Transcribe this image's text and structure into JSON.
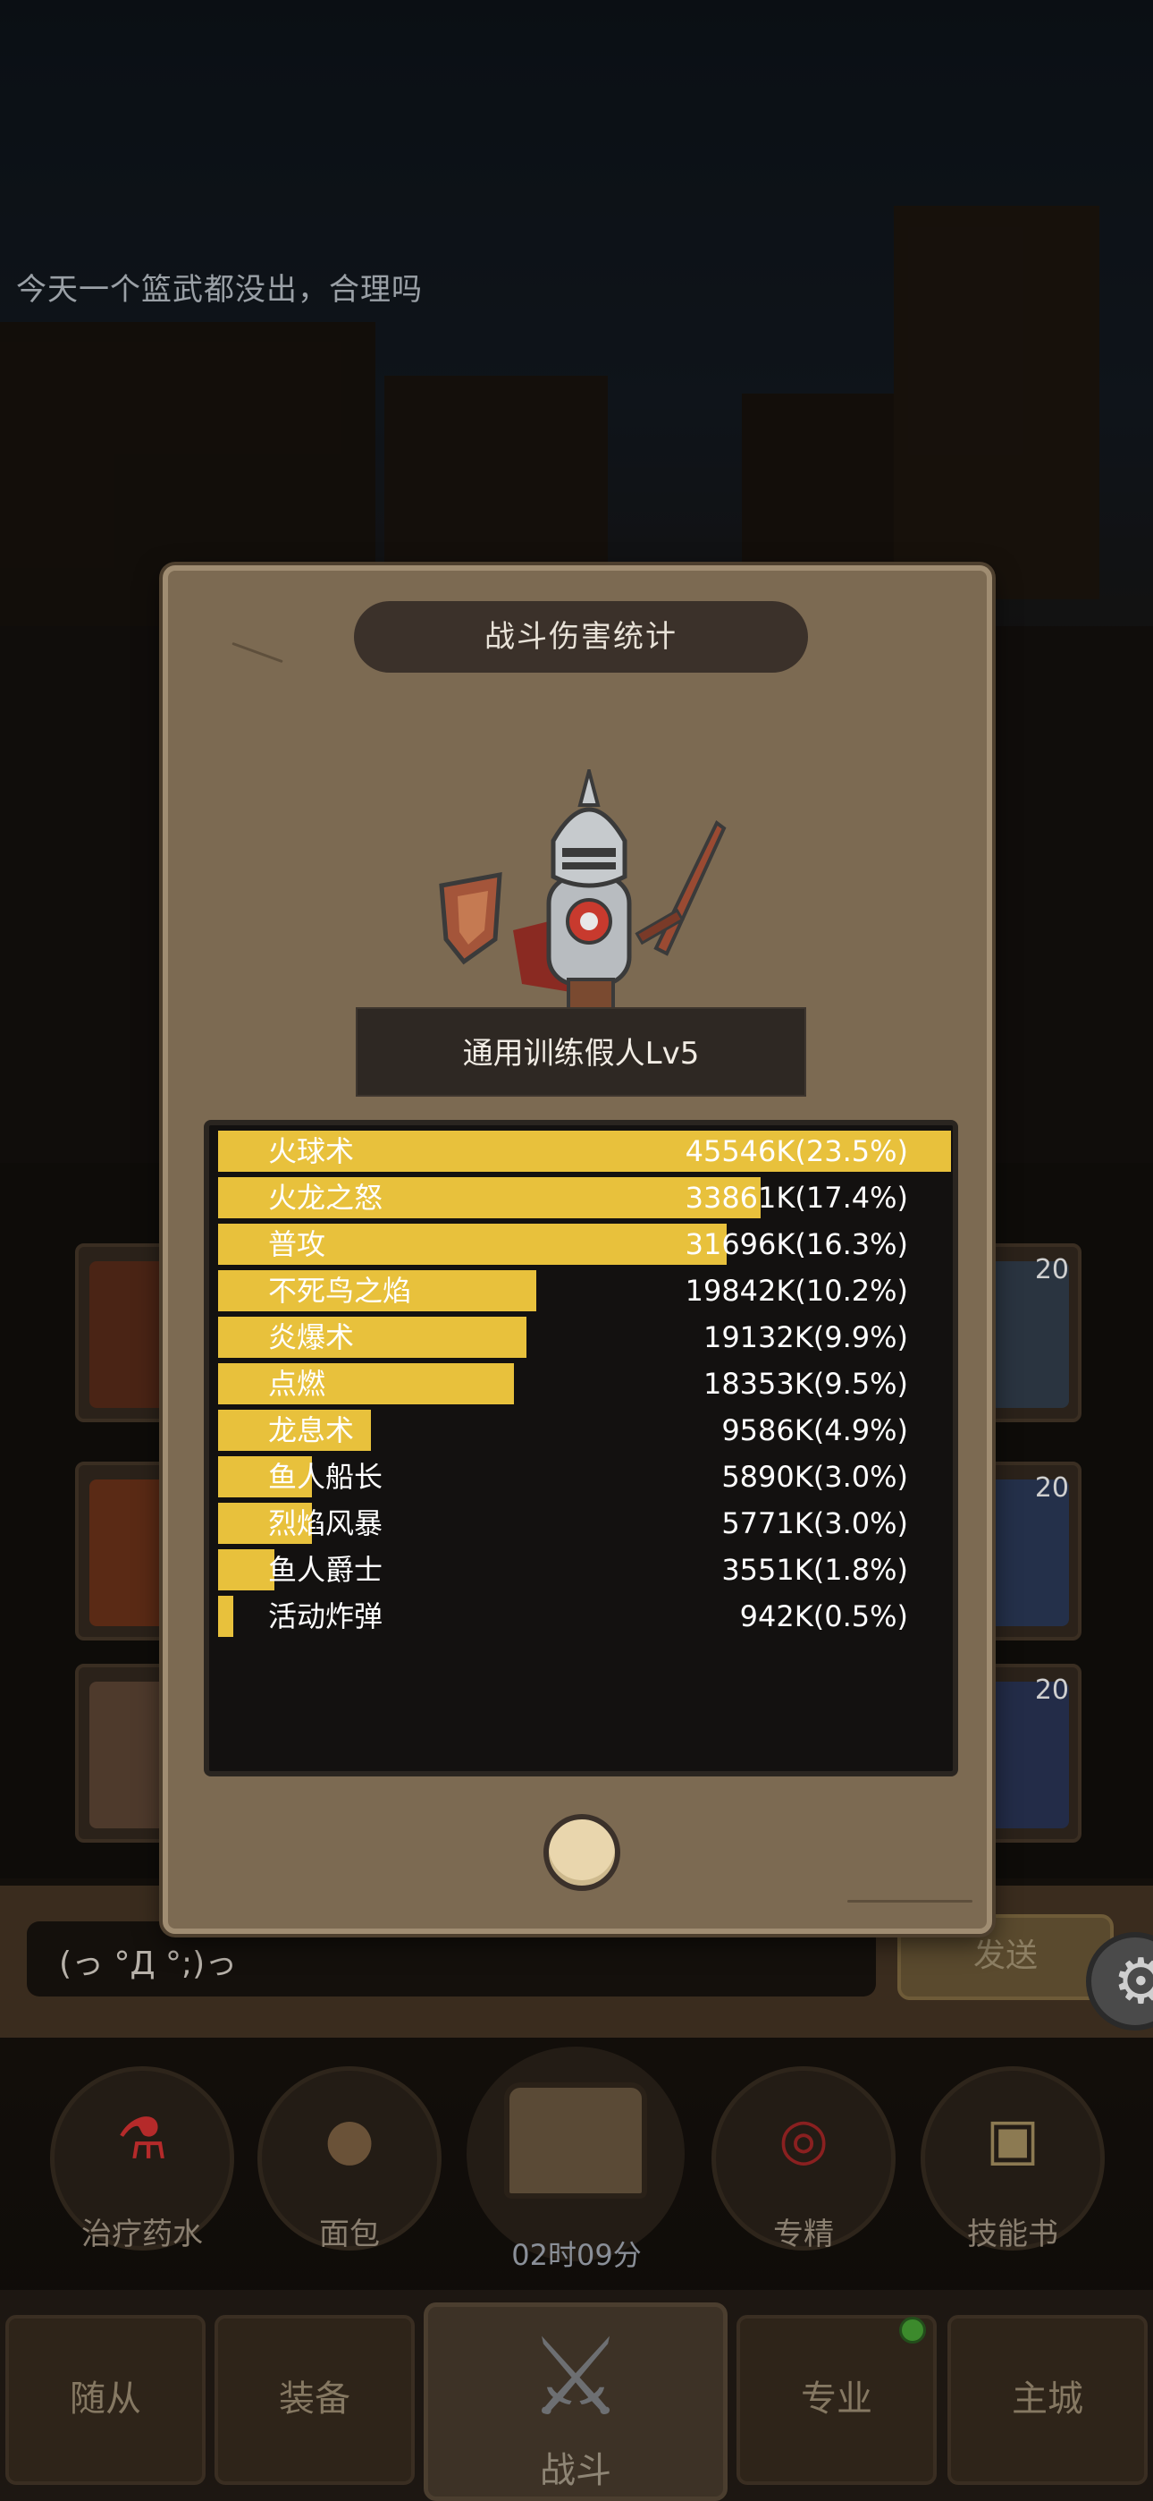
{
  "background": {
    "chat_message": "今天一个篮武都没出，合理吗",
    "slots": [
      {
        "level": "20"
      },
      {
        "level": "20"
      },
      {
        "level": "20"
      }
    ]
  },
  "chat": {
    "input_value": "(っ °Д °;)っ",
    "send_label": "发送"
  },
  "items": [
    {
      "label": "治疗药水",
      "icon": "potion-icon"
    },
    {
      "label": "面包",
      "icon": "bread-icon"
    },
    {
      "label": "专精",
      "icon": "specialization-icon"
    },
    {
      "label": "技能书",
      "icon": "skill-book-icon"
    }
  ],
  "chest_timer": "02时09分",
  "nav": {
    "tabs": [
      "随从",
      "装备",
      "战斗",
      "专业",
      "主城"
    ]
  },
  "modal": {
    "title": "战斗伤害统计",
    "target_name": "通用训练假人Lv5"
  },
  "damage_stats": [
    {
      "skill": "火球术",
      "damage": "45546K(23.5%)",
      "share": 23.5
    },
    {
      "skill": "火龙之怒",
      "damage": "33861K(17.4%)",
      "share": 17.4
    },
    {
      "skill": "普攻",
      "damage": "31696K(16.3%)",
      "share": 16.3
    },
    {
      "skill": "不死鸟之焰",
      "damage": "19842K(10.2%)",
      "share": 10.2
    },
    {
      "skill": "炎爆术",
      "damage": "19132K(9.9%)",
      "share": 9.9
    },
    {
      "skill": "点燃",
      "damage": "18353K(9.5%)",
      "share": 9.5
    },
    {
      "skill": "龙息术",
      "damage": "9586K(4.9%)",
      "share": 4.9
    },
    {
      "skill": "鱼人船长",
      "damage": "5890K(3.0%)",
      "share": 3.0
    },
    {
      "skill": "烈焰风暴",
      "damage": "5771K(3.0%)",
      "share": 3.0
    },
    {
      "skill": "鱼人爵士",
      "damage": "3551K(1.8%)",
      "share": 1.8
    },
    {
      "skill": "活动炸弹",
      "damage": "942K(0.5%)",
      "share": 0.5
    }
  ],
  "colors": {
    "bar": "#e8c13c",
    "panel": "#7c6a52"
  }
}
